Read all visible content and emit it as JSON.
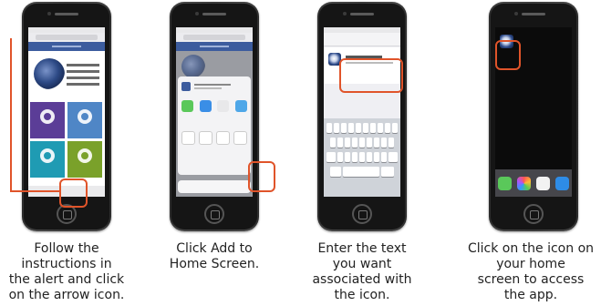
{
  "steps": [
    {
      "id": "step-1",
      "caption_lines": [
        "Follow the",
        "instructions in",
        "the alert and click",
        "on the arrow icon."
      ]
    },
    {
      "id": "step-2",
      "caption_lines": [
        "Click Add to",
        "Home Screen."
      ]
    },
    {
      "id": "step-3",
      "caption_lines": [
        "Enter the text",
        "you want",
        "associated with",
        "the icon."
      ]
    },
    {
      "id": "step-4",
      "caption_lines": [
        "Click on the icon on",
        "your home",
        "screen to access",
        "the app."
      ]
    }
  ],
  "colors": {
    "highlight": "#e0542a",
    "site_header": "#3c5c9e",
    "tile_purple": "#5b3d97",
    "tile_blue": "#4f86c6",
    "tile_teal": "#1f9bb3",
    "tile_green": "#7aa12a"
  },
  "icons": {
    "share_arrow": "share-arrow-icon",
    "app": "app-shortcut-icon"
  }
}
